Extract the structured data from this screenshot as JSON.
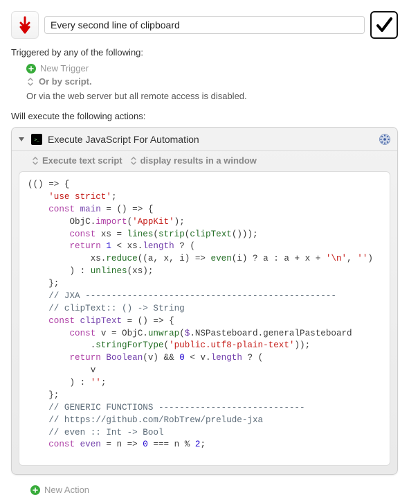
{
  "header": {
    "macro_title": "Every second line of clipboard"
  },
  "triggers": {
    "heading": "Triggered by any of the following:",
    "new_trigger_label": "New Trigger",
    "or_by_script_label": "Or by script.",
    "remote_disabled_label": "Or via the web server but all remote access is disabled."
  },
  "actions_heading": "Will execute the following actions:",
  "action": {
    "title": "Execute JavaScript For Automation",
    "script_mode": "Execute text script",
    "display_mode": "display results in a window"
  },
  "code": {
    "l01_a": "(() => {",
    "l02_a": "    ",
    "l02_b": "'use strict'",
    "l02_c": ";",
    "l03_a": "",
    "l04_a": "    ",
    "l04_b": "const",
    "l04_c": " ",
    "l04_d": "main",
    "l04_e": " = () => {",
    "l05_a": "        ObjC.",
    "l05_b": "import",
    "l05_c": "(",
    "l05_d": "'AppKit'",
    "l05_e": ");",
    "l06_a": "",
    "l07_a": "        ",
    "l07_b": "const",
    "l07_c": " xs = ",
    "l07_d": "lines",
    "l07_e": "(",
    "l07_f": "strip",
    "l07_g": "(",
    "l07_h": "clipText",
    "l07_i": "()));",
    "l08_a": "        ",
    "l08_b": "return",
    "l08_c": " ",
    "l08_d": "1",
    "l08_e": " < xs.",
    "l08_f": "length",
    "l08_g": " ? (",
    "l09_a": "            xs.",
    "l09_b": "reduce",
    "l09_c": "((a, x, i) => ",
    "l09_d": "even",
    "l09_e": "(i) ? a : a + x + ",
    "l09_f": "'\\n'",
    "l09_g": ", ",
    "l09_h": "''",
    "l09_i": ")",
    "l10_a": "        ) : ",
    "l10_b": "unlines",
    "l10_c": "(xs);",
    "l11_a": "    };",
    "l12_a": "",
    "l13_a": "    ",
    "l13_b": "// JXA ------------------------------------------------",
    "l14_a": "",
    "l15_a": "    ",
    "l15_b": "// clipText:: () -> String",
    "l16_a": "    ",
    "l16_b": "const",
    "l16_c": " ",
    "l16_d": "clipText",
    "l16_e": " = () => {",
    "l17_a": "        ",
    "l17_b": "const",
    "l17_c": " v = ObjC.",
    "l17_d": "unwrap",
    "l17_e": "(",
    "l17_f": "$",
    "l17_g": ".NSPasteboard.generalPasteboard",
    "l18_a": "            .",
    "l18_b": "stringForType",
    "l18_c": "(",
    "l18_d": "'public.utf8-plain-text'",
    "l18_e": "));",
    "l19_a": "        ",
    "l19_b": "return",
    "l19_c": " ",
    "l19_d": "Boolean",
    "l19_e": "(v) && ",
    "l19_f": "0",
    "l19_g": " < v.",
    "l19_h": "length",
    "l19_i": " ? (",
    "l20_a": "            v",
    "l21_a": "        ) : ",
    "l21_b": "''",
    "l21_c": ";",
    "l22_a": "    };",
    "l23_a": "",
    "l24_a": "    ",
    "l24_b": "// GENERIC FUNCTIONS ----------------------------",
    "l25_a": "    ",
    "l25_b": "// https://github.com/RobTrew/prelude-jxa",
    "l26_a": "",
    "l27_a": "    ",
    "l27_b": "// even :: Int -> Bool",
    "l28_a": "    ",
    "l28_b": "const",
    "l28_c": " ",
    "l28_d": "even",
    "l28_e": " = n => ",
    "l28_f": "0",
    "l28_g": " === n % ",
    "l28_h": "2",
    "l28_i": ";"
  },
  "new_action_label": "New Action"
}
